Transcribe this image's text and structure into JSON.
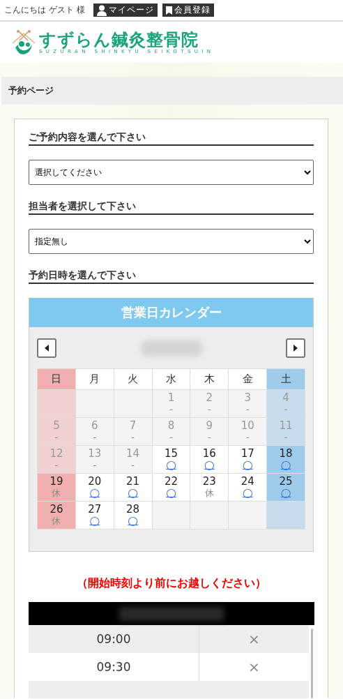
{
  "top_bar": {
    "greeting": "こんにちは ゲスト 様",
    "links": [
      {
        "label": "マイページ"
      },
      {
        "label": "会員登録"
      }
    ]
  },
  "logo": {
    "name": "すずらん鍼灸整骨院",
    "romaji": "SUZURAN SHINKYU SEIKOTSUIN"
  },
  "page_title": "予約ページ",
  "form": {
    "sections": [
      {
        "heading": "ご予約内容を選んで下さい",
        "select": "選択してください"
      },
      {
        "heading": "担当者を選択して下さい",
        "select": "指定無し"
      },
      {
        "heading": "予約日時を選んで下さい"
      }
    ]
  },
  "calendar": {
    "title": "営業日カレンダー",
    "weekdays": [
      "日",
      "月",
      "火",
      "水",
      "木",
      "金",
      "土"
    ],
    "weeks": [
      [
        {
          "kind": "empty"
        },
        {
          "kind": "empty"
        },
        {
          "kind": "empty"
        },
        {
          "day": "1",
          "mark": "-",
          "kind": "past"
        },
        {
          "day": "2",
          "mark": "-",
          "kind": "past"
        },
        {
          "day": "3",
          "mark": "-",
          "kind": "past"
        },
        {
          "day": "4",
          "mark": "-",
          "kind": "past"
        }
      ],
      [
        {
          "day": "5",
          "mark": "-",
          "kind": "past"
        },
        {
          "day": "6",
          "mark": "-",
          "kind": "past"
        },
        {
          "day": "7",
          "mark": "-",
          "kind": "past"
        },
        {
          "day": "8",
          "mark": "-",
          "kind": "past"
        },
        {
          "day": "9",
          "mark": "-",
          "kind": "past"
        },
        {
          "day": "10",
          "mark": "-",
          "kind": "past"
        },
        {
          "day": "11",
          "mark": "-",
          "kind": "past"
        }
      ],
      [
        {
          "day": "12",
          "mark": "-",
          "kind": "past"
        },
        {
          "day": "13",
          "mark": "-",
          "kind": "past"
        },
        {
          "day": "14",
          "mark": "-",
          "kind": "past"
        },
        {
          "day": "15",
          "mark": "◯",
          "kind": "open"
        },
        {
          "day": "16",
          "mark": "◯",
          "kind": "open"
        },
        {
          "day": "17",
          "mark": "◯",
          "kind": "open"
        },
        {
          "day": "18",
          "mark": "◯",
          "kind": "open"
        }
      ],
      [
        {
          "day": "19",
          "mark": "休",
          "kind": "closed"
        },
        {
          "day": "20",
          "mark": "◯",
          "kind": "open"
        },
        {
          "day": "21",
          "mark": "◯",
          "kind": "open"
        },
        {
          "day": "22",
          "mark": "◯",
          "kind": "open"
        },
        {
          "day": "23",
          "mark": "休",
          "kind": "closed"
        },
        {
          "day": "24",
          "mark": "◯",
          "kind": "open"
        },
        {
          "day": "25",
          "mark": "◯",
          "kind": "open"
        }
      ],
      [
        {
          "day": "26",
          "mark": "休",
          "kind": "closed"
        },
        {
          "day": "27",
          "mark": "◯",
          "kind": "open"
        },
        {
          "day": "28",
          "mark": "◯",
          "kind": "open"
        },
        {
          "kind": "empty"
        },
        {
          "kind": "empty"
        },
        {
          "kind": "empty"
        },
        {
          "kind": "empty"
        }
      ]
    ]
  },
  "notice": "（開始時刻より前にお越しください）",
  "time_slots": [
    {
      "time": "09:00",
      "mark": "×"
    },
    {
      "time": "09:30",
      "mark": "×"
    }
  ]
}
